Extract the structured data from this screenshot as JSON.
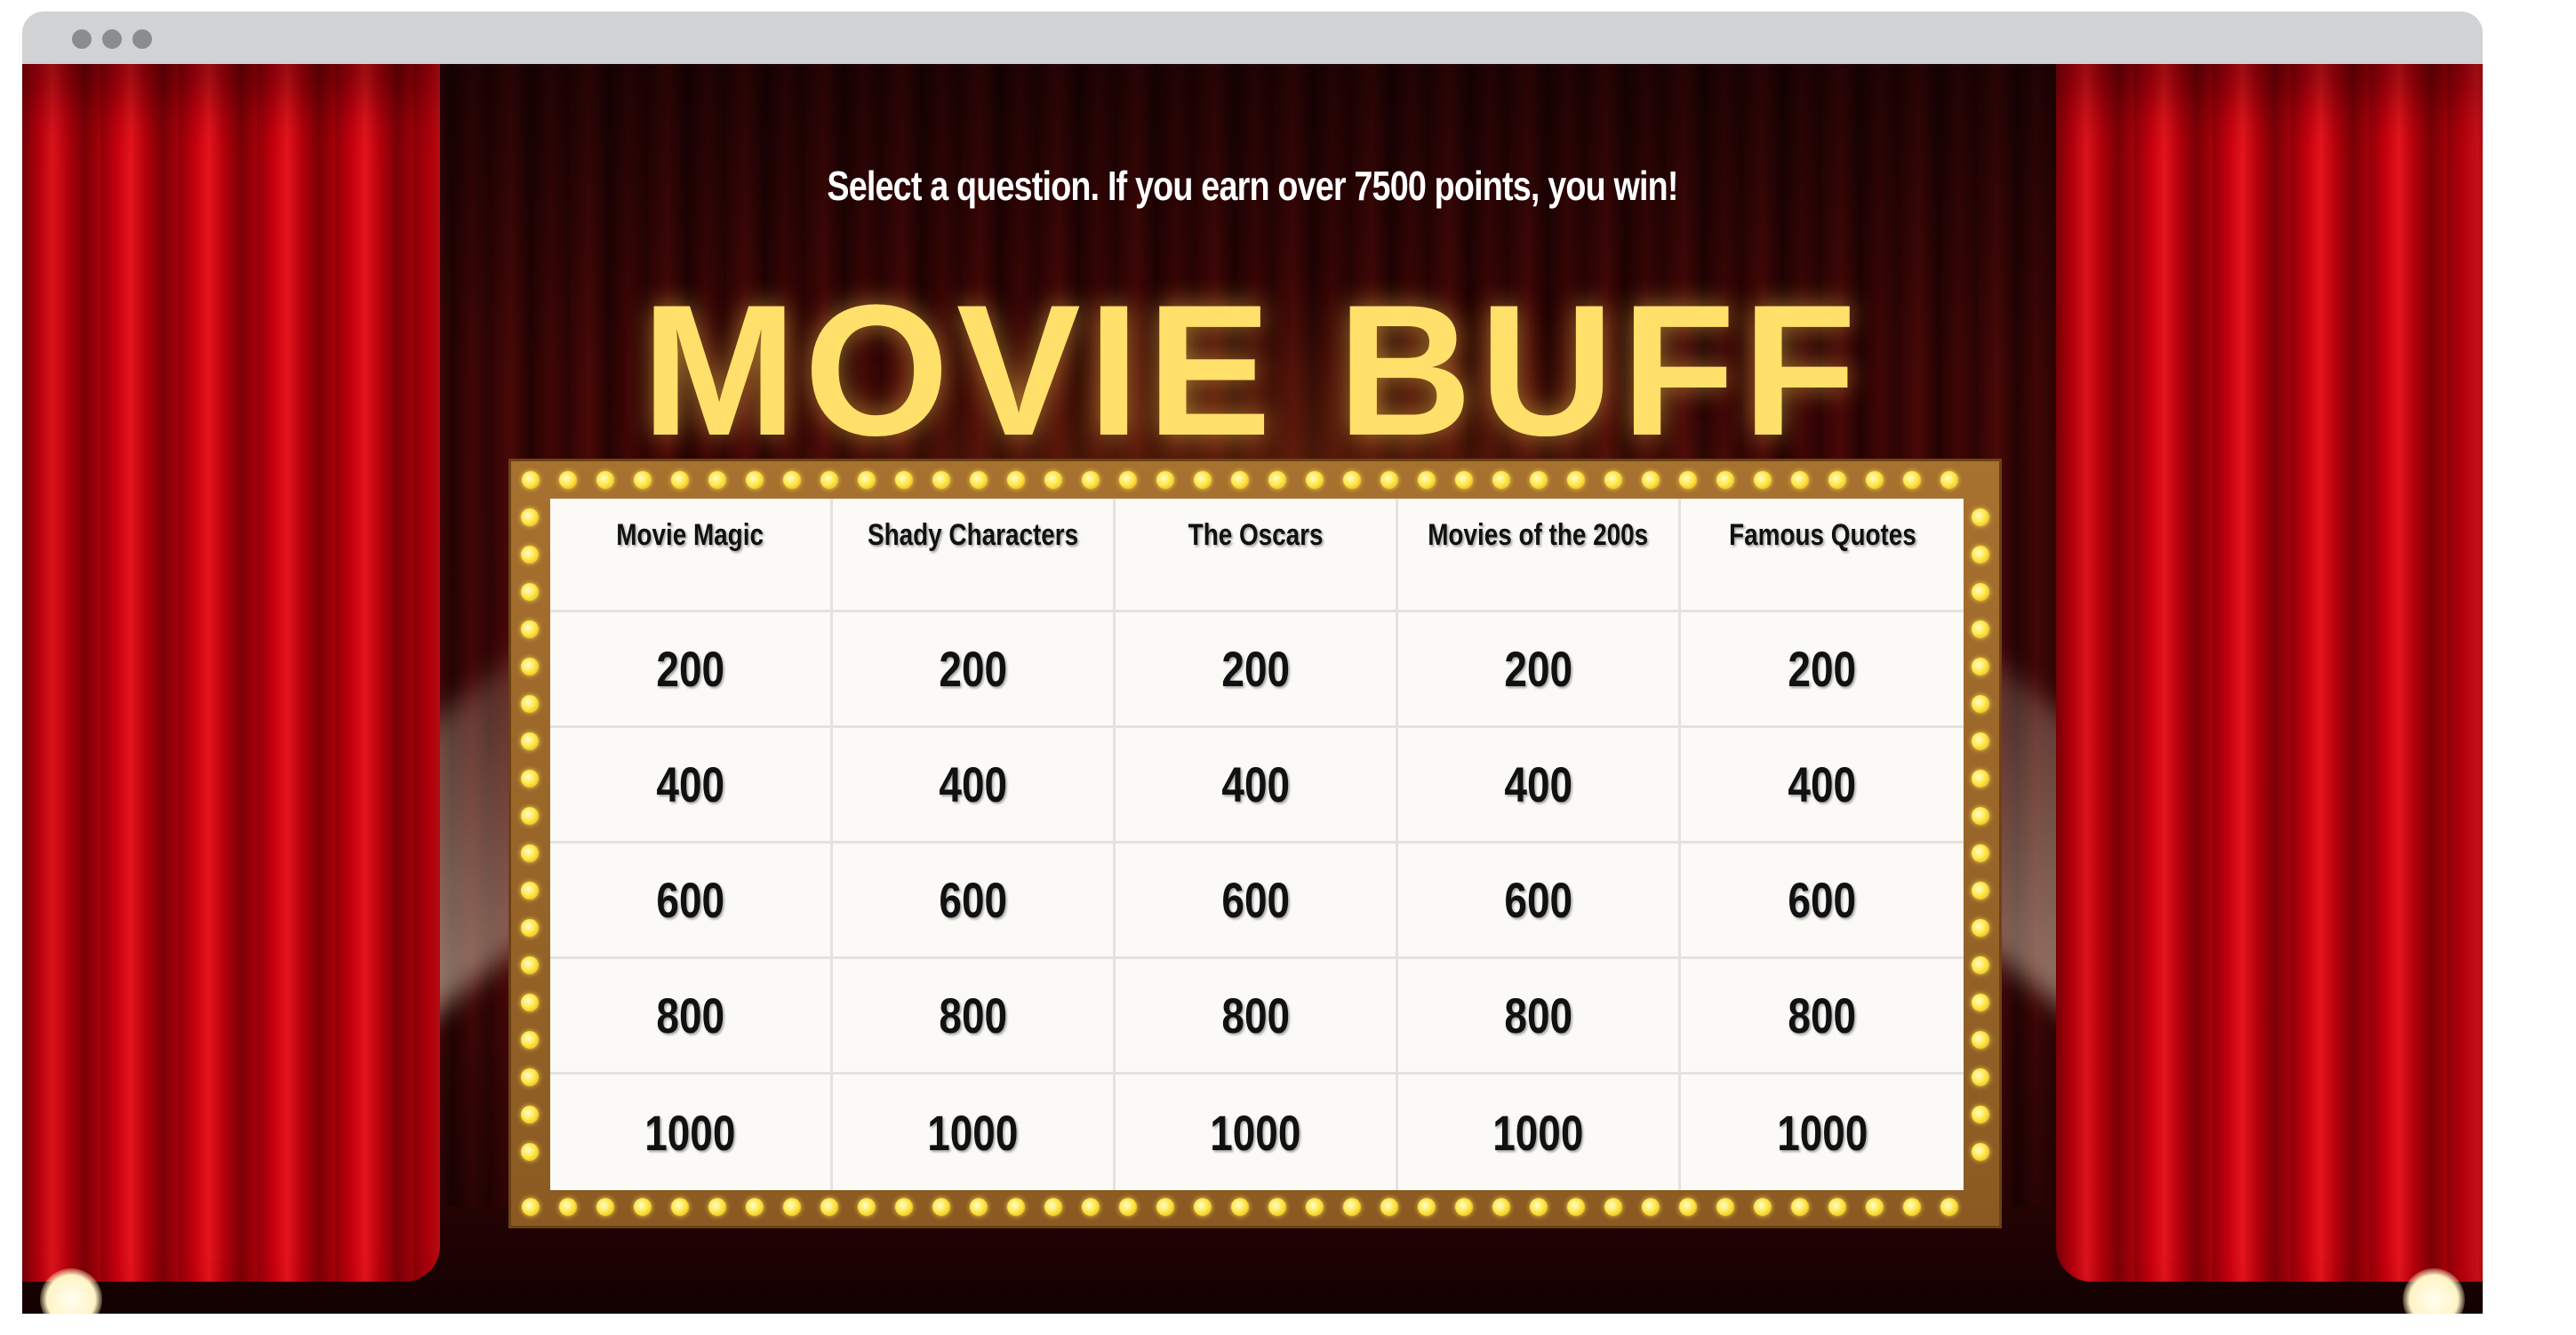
{
  "instruction": "Select a question. If you earn over 7500 points, you win!",
  "title": "MOVIE BUFF",
  "board": {
    "categories": [
      "Movie Magic",
      "Shady Characters",
      "The Oscars",
      "Movies of the 200s",
      "Famous Quotes"
    ],
    "values": [
      "200",
      "400",
      "600",
      "800",
      "1000"
    ]
  },
  "colors": {
    "title": "#ffe06a",
    "curtain": "#c4000d",
    "frame": "#a7712f",
    "bulb": "#ffe84a",
    "board": "#fbfaf7"
  }
}
